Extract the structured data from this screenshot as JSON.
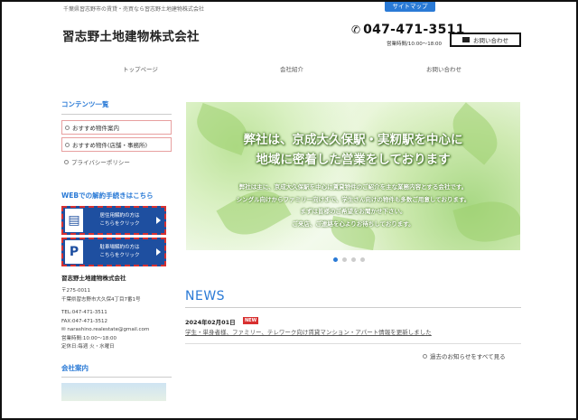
{
  "header": {
    "tagline": "千葉県習志野市の賃貸・売買なら習志野土地建物株式会社",
    "sitemap_label": "サイトマップ",
    "company_logo": "習志野土地建物株式会社",
    "phone": "047-471-3511",
    "hours": "営業時間/10:00〜18:00",
    "contact_label": "お問い合わせ"
  },
  "nav": {
    "items": [
      "トップページ",
      "会社紹介",
      "お問い合わせ"
    ]
  },
  "sidebar": {
    "contents_heading": "コンテンツ一覧",
    "items": [
      "おすすめ物件案内",
      "おすすめ物件(店舗・事務所)",
      "プライバシーポリシー"
    ],
    "web_heading": "WEBでの解約手続きはこちら",
    "banner_residential": {
      "line1": "居住用解約の方は",
      "line2": "こちらをクリック"
    },
    "banner_parking": {
      "line1": "駐車場解約の方は",
      "line2": "こちらをクリック"
    },
    "company_name": "習志野土地建物株式会社",
    "postal": "〒275-0011",
    "address": "千葉県習志野市大久保4丁目7番1号",
    "tel": "TEL:047-471-3511",
    "fax": "FAX:047-471-3512",
    "email": "narashino.realestate@gmail.com",
    "business_hours": "営業時間:10:00〜18:00",
    "holiday": "定休日:毎週 火・水曜日",
    "company_heading": "会社案内"
  },
  "hero": {
    "title_line1": "弊社は、京成大久保駅・実籾駅を中心に",
    "title_line2": "地域に密着した営業をしております",
    "body_line1": "弊社は主に、京成大久保駅を中心に賃貸物件のご紹介を主な業務内容とする会社です。",
    "body_line2": "シングル向けからファミリー向けまで、学生さん向けの物件も多数ご用意しております。",
    "body_line3": "まずは皆様のご希望をお聞かせ下さい。",
    "body_line4": "ご来店、ご連絡を心よりお待ちしております。"
  },
  "carousel": {
    "count": 4,
    "active": 1
  },
  "news": {
    "heading": "NEWS",
    "date": "2024年02月01日",
    "badge": "NEW",
    "text": "学生・単身者様、ファミリー、テレワーク向け賃貸マンション・アパート情報を更新しました",
    "past_link": "過去のお知らせをすべて見る"
  },
  "colors": {
    "accent": "#2a7ad6",
    "banner": "#1e4fa0",
    "badge": "#d83030"
  }
}
